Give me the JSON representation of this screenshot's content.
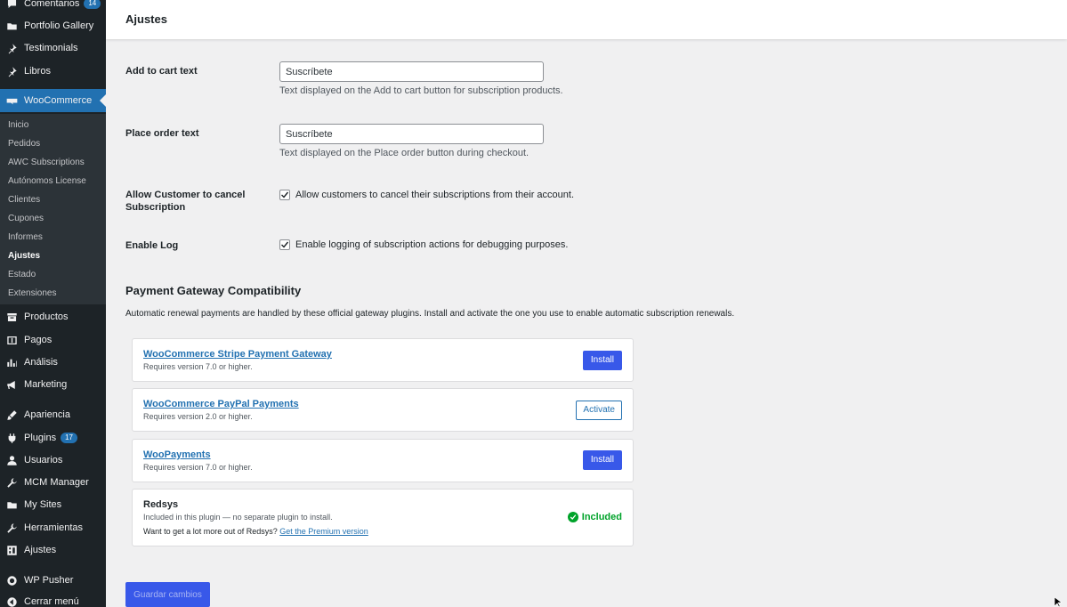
{
  "sidebar": {
    "items": [
      {
        "label": "Comentarios",
        "icon": "comment-icon",
        "badge": "14"
      },
      {
        "label": "Portfolio Gallery",
        "icon": "folder-icon"
      },
      {
        "label": "Testimonials",
        "icon": "pin-icon"
      },
      {
        "label": "Libros",
        "icon": "pin-icon"
      },
      {
        "label": "WooCommerce",
        "icon": "woo-icon",
        "active": true
      },
      {
        "label": "Productos",
        "icon": "archive-icon"
      },
      {
        "label": "Pagos",
        "icon": "money-icon"
      },
      {
        "label": "Análisis",
        "icon": "chart-icon"
      },
      {
        "label": "Marketing",
        "icon": "megaphone-icon"
      },
      {
        "label": "Apariencia",
        "icon": "brush-icon"
      },
      {
        "label": "Plugins",
        "icon": "plugin-icon",
        "badge": "17"
      },
      {
        "label": "Usuarios",
        "icon": "user-icon"
      },
      {
        "label": "MCM Manager",
        "icon": "wrench-icon"
      },
      {
        "label": "My Sites",
        "icon": "folder-icon"
      },
      {
        "label": "Herramientas",
        "icon": "wrench-icon"
      },
      {
        "label": "Ajustes",
        "icon": "settings-icon"
      },
      {
        "label": "WP Pusher",
        "icon": "circle-icon"
      },
      {
        "label": "Cerrar menú",
        "icon": "collapse-icon"
      }
    ],
    "submenu": [
      "Inicio",
      "Pedidos",
      "AWC Subscriptions",
      "Autónomos License",
      "Clientes",
      "Cupones",
      "Informes",
      "Ajustes",
      "Estado",
      "Extensiones"
    ],
    "submenu_current": "Ajustes"
  },
  "header": {
    "title": "Ajustes"
  },
  "settings": {
    "add_to_cart": {
      "label": "Add to cart text",
      "value": "Suscríbete",
      "desc": "Text displayed on the Add to cart button for subscription products."
    },
    "place_order": {
      "label": "Place order text",
      "value": "Suscríbete",
      "desc": "Text displayed on the Place order button during checkout."
    },
    "allow_cancel": {
      "label_line1": "Allow Customer to cancel",
      "label_line2": "Subscription",
      "text": "Allow customers to cancel their subscriptions from their account.",
      "checked": true
    },
    "enable_log": {
      "label": "Enable Log",
      "text": "Enable logging of subscription actions for debugging purposes.",
      "checked": true
    }
  },
  "gateways": {
    "title": "Payment Gateway Compatibility",
    "desc": "Automatic renewal payments are handled by these official gateway plugins. Install and activate the one you use to enable automatic subscription renewals.",
    "cards": [
      {
        "name": "WooCommerce Stripe Payment Gateway",
        "req": "Requires version 7.0 or higher.",
        "action": "Install"
      },
      {
        "name": "WooCommerce PayPal Payments",
        "req": "Requires version 2.0 or higher.",
        "action": "Activate"
      },
      {
        "name": "WooPayments",
        "req": "Requires version 7.0 or higher.",
        "action": "Install"
      },
      {
        "name": "Redsys",
        "req": "Included in this plugin — no separate plugin to install.",
        "extra_text": "Want to get a lot more out of Redsys?",
        "extra_link": "Get the Premium version",
        "status": "Included"
      }
    ]
  },
  "save_label": "Guardar cambios",
  "colors": {
    "sidebar": "#1d2327",
    "accent": "#2271b1",
    "primary_button": "#3858e9",
    "success": "#00a32a"
  }
}
